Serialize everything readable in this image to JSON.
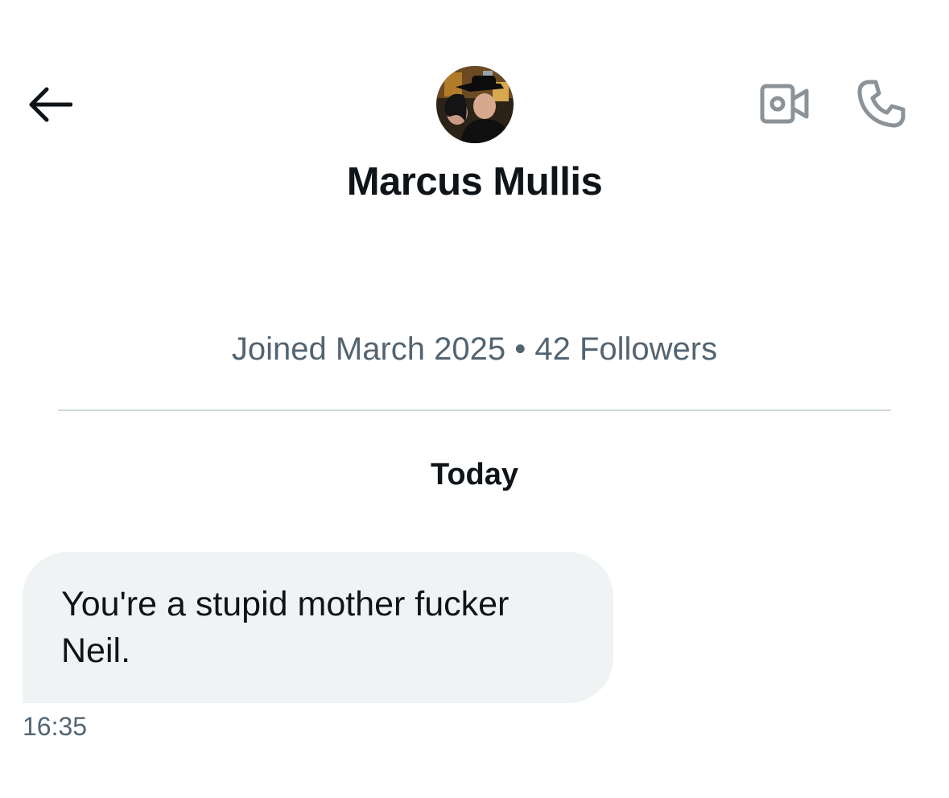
{
  "header": {
    "name": "Marcus Mullis",
    "icons": {
      "back": "arrow-left-icon",
      "video": "video-camera-icon",
      "phone": "phone-icon"
    }
  },
  "profile": {
    "meta": "Joined March 2025 • 42 Followers"
  },
  "conversation": {
    "date_label": "Today",
    "messages": [
      {
        "text": "You're a stupid mother fucker Neil.",
        "time": "16:35"
      }
    ]
  },
  "colors": {
    "text_primary": "#0f1419",
    "text_secondary": "#536471",
    "bubble_background": "#eff3f4",
    "divider": "#cfd9de",
    "icon_gray": "#8b9298"
  }
}
